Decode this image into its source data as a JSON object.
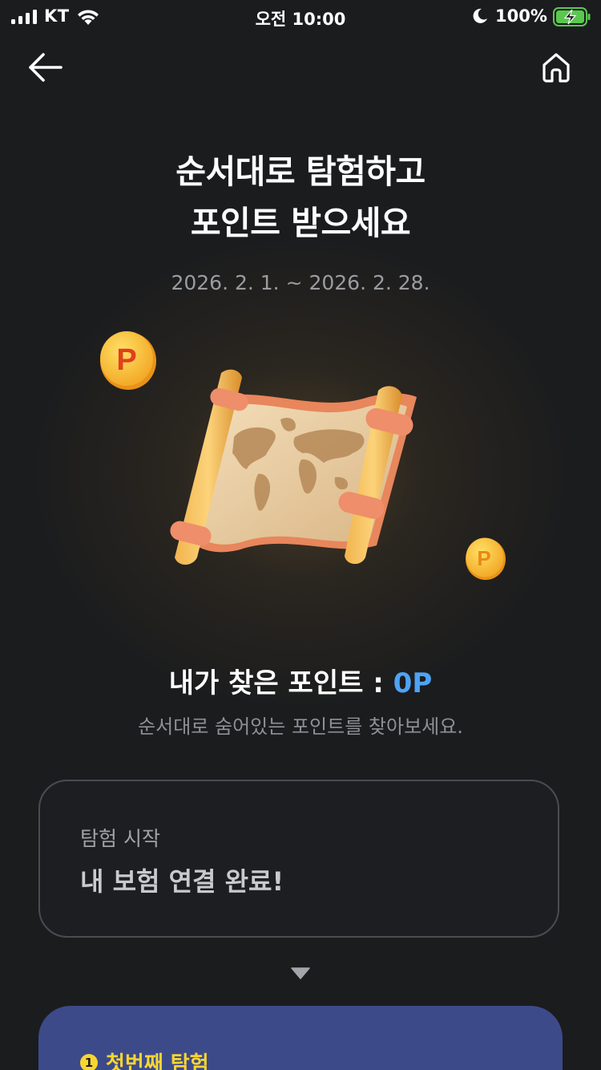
{
  "status_bar": {
    "carrier": "KT",
    "time": "오전 10:00",
    "battery_percent": "100%"
  },
  "header": {
    "back_icon": "arrow-left-icon",
    "home_icon": "home-icon"
  },
  "hero": {
    "title_line1": "순서대로 탐험하고",
    "title_line2": "포인트 받으세요",
    "period": "2026. 2. 1. ~ 2026. 2. 28.",
    "illustration_icon": "treasure-map-icon",
    "coin_letter": "P"
  },
  "points": {
    "label": "내가 찾은 포인트 : ",
    "value": "0P",
    "hint": "순서대로 숨어있는 포인트를 찾아보세요."
  },
  "start_card": {
    "caption": "탐험 시작",
    "title": "내 보험 연결 완료!"
  },
  "quest_card": {
    "number": "1",
    "label": "첫번째 탐험"
  },
  "colors": {
    "background": "#1b1c1e",
    "accent_blue": "#4ea3f5",
    "quest_card": "#3d4a8a",
    "quest_label": "#f7d532"
  }
}
